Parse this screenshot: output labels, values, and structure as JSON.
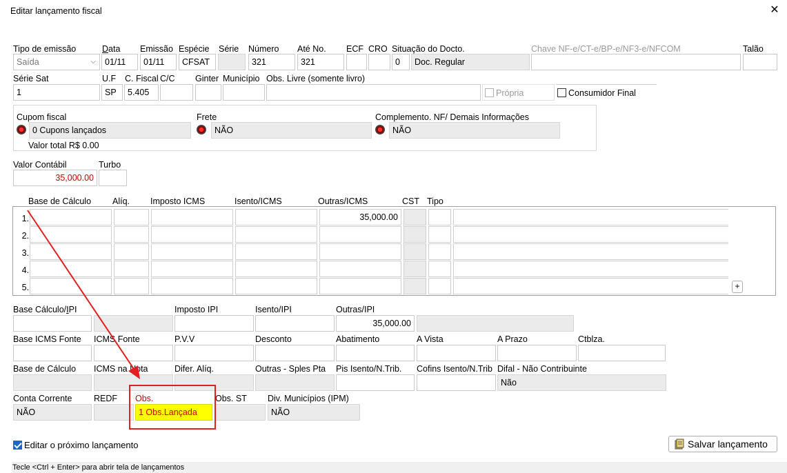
{
  "window": {
    "title": "Editar lançamento fiscal",
    "close_glyph": "✕"
  },
  "row1": {
    "tipo_emissao_label": "Tipo de emissão",
    "tipo_emissao_value": "Saída",
    "data_label": "Data",
    "data_value": "01/11",
    "emissao_label": "Emissão",
    "emissao_value": "01/11",
    "especie_label": "Espécie",
    "especie_value": "CFSAT",
    "serie_label": "Série",
    "serie_value": "",
    "numero_label": "Número",
    "numero_value": "321",
    "ate_no_label": "Até No.",
    "ate_no_value": "321",
    "ecf_label": "ECF",
    "ecf_value": "",
    "cro_label": "CRO",
    "cro_value": "",
    "situacao_label": "Situação do Docto.",
    "situacao_code": "0",
    "situacao_value": "Doc. Regular",
    "chave_label": "Chave NF-e/CT-e/BP-e/NF3-e/NFCOM",
    "chave_value": "",
    "talao_label": "Talão",
    "talao_value": ""
  },
  "row2": {
    "serie_sat_label": "Série Sat",
    "serie_sat_value": "1",
    "uf_label": "U.F",
    "uf_value": "SP",
    "cfiscal_label": "C. Fiscal",
    "cfiscal_value": "5.405",
    "cc_label": "C/C",
    "cc_value": "",
    "ginter_label": "Ginter",
    "ginter_value": "",
    "municipio_label": "Município",
    "municipio_value": "",
    "obs_livre_label": "Obs. Livre (somente livro)",
    "obs_livre_value": "",
    "propria_label": "Própria",
    "consumidor_final_label": "Consumidor Final"
  },
  "group": {
    "cupom_label": "Cupom fiscal",
    "cupom_value": "0 Cupons lançados",
    "valor_total": "Valor total R$ 0.00",
    "frete_label": "Frete",
    "frete_value": "NÃO",
    "complemento_label": "Complemento. NF/ Demais Informações",
    "complemento_value": "NÃO"
  },
  "valor_contabil": {
    "label": "Valor Contábil",
    "value": "35,000.00"
  },
  "turbo": {
    "label": "Turbo",
    "value": ""
  },
  "icms_grid": {
    "headers": {
      "base": "Base de Cálculo",
      "aliq": "Alíq.",
      "imposto": "Imposto ICMS",
      "isento": "Isento/ICMS",
      "outras": "Outras/ICMS",
      "cst": "CST",
      "tipo": "Tipo"
    },
    "rows": [
      {
        "num": "1.",
        "outras": "35,000.00"
      },
      {
        "num": "2.",
        "outras": ""
      },
      {
        "num": "3.",
        "outras": ""
      },
      {
        "num": "4.",
        "outras": ""
      },
      {
        "num": "5.",
        "outras": ""
      }
    ],
    "add_label": "+"
  },
  "ipi": {
    "base_label": "Base Cálculo/IPI",
    "imposto_label": "Imposto IPI",
    "isento_label": "Isento/IPI",
    "outras_label": "Outras/IPI",
    "outras_value": "35,000.00"
  },
  "row_fonte": {
    "base_icms_fonte": "Base ICMS Fonte",
    "icms_fonte": "ICMS Fonte",
    "pvv": "P.V.V",
    "desconto": "Desconto",
    "abatimento": "Abatimento",
    "a_vista": "A Vista",
    "a_prazo": "A Prazo",
    "ctblza": "Ctblza."
  },
  "row_base": {
    "base_calculo": "Base de Cálculo",
    "icms_na_nota": "ICMS na Nota",
    "difer_aliq": "Difer. Alíq.",
    "outras_sples": "Outras - Sples Pta",
    "pis": "Pis Isento/N.Trib.",
    "cofins": "Cofins Isento/N.Trib",
    "difal_label": "Difal - Não Contribuinte",
    "difal_value": "Não"
  },
  "row_conta": {
    "conta_label": "Conta Corrente",
    "conta_value": "NÃO",
    "redf_label": "REDF",
    "obs_label": "Obs.",
    "obs_value": "1 Obs.Lançada",
    "obs_st_label": "Obs. ST",
    "div_label": "Div. Municípios (IPM)",
    "div_value": "NÃO"
  },
  "footer": {
    "editar_proximo": "Editar o próximo lançamento",
    "salvar": "Salvar lançamento",
    "status": "Tecle <Ctrl + Enter> para abrir tela de lançamentos"
  },
  "colors": {
    "highlight_yellow": "#ffff00",
    "annotation_red": "#e02020"
  }
}
